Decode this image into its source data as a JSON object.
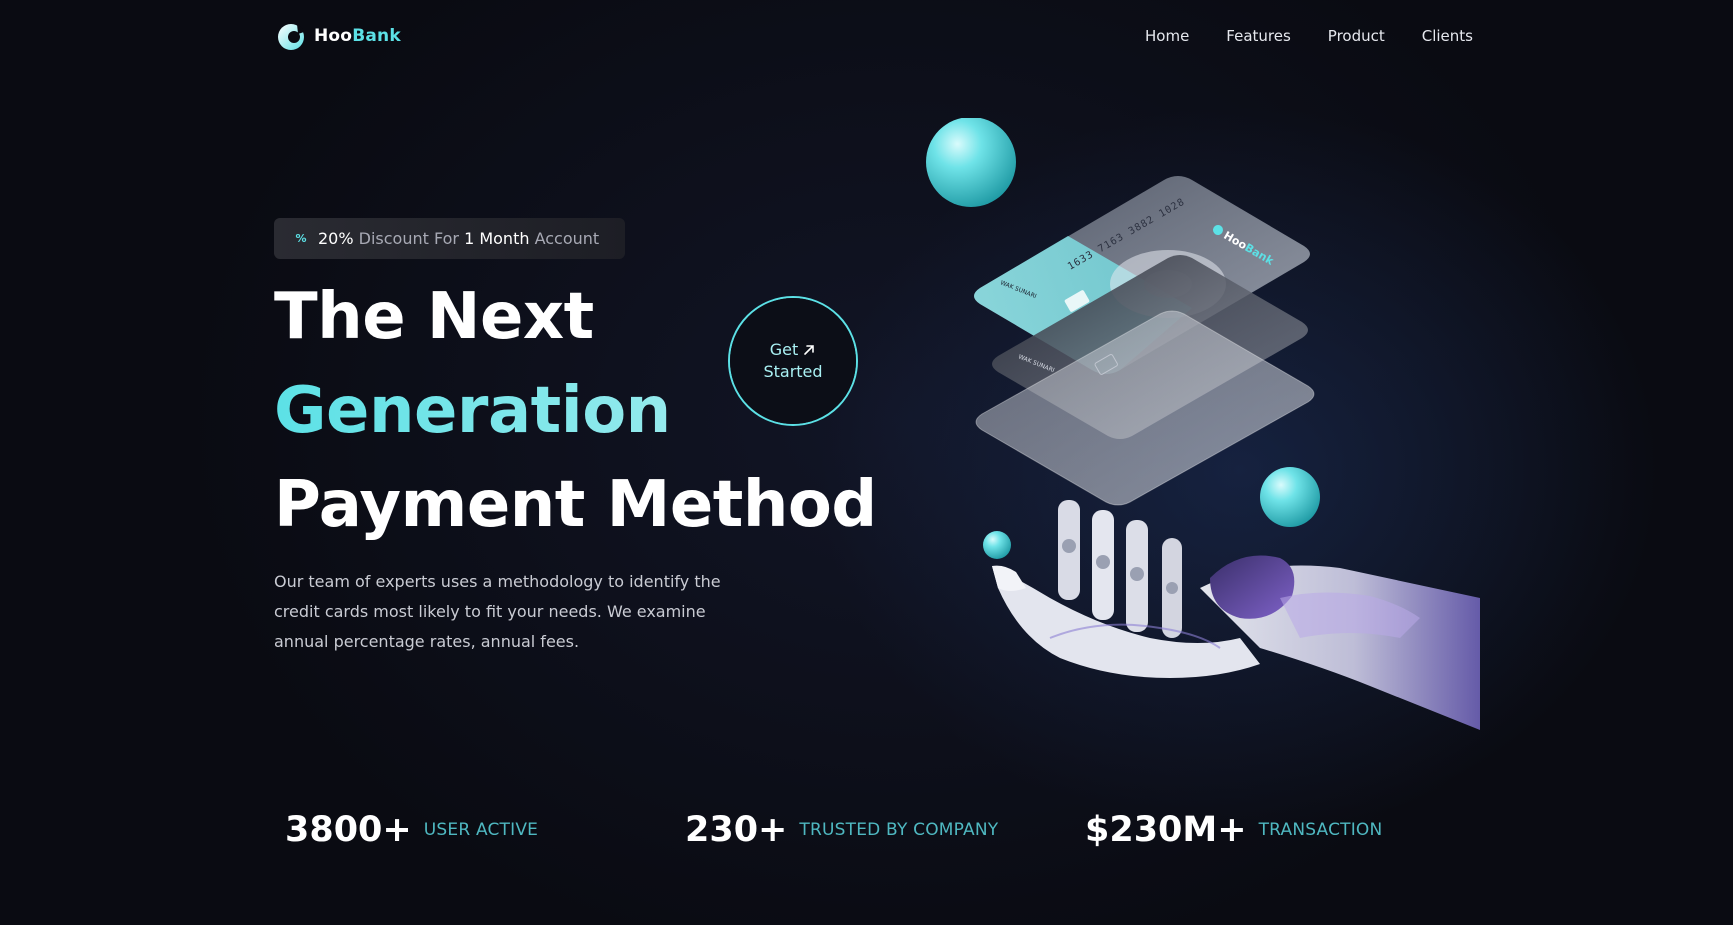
{
  "brand": {
    "name_part1": "Hoo",
    "name_part2": "Bank",
    "accent_color": "#5ce1e6",
    "logo_icon": "hoobank-logo-icon"
  },
  "nav": {
    "items": [
      {
        "label": "Home"
      },
      {
        "label": "Features"
      },
      {
        "label": "Product"
      },
      {
        "label": "Clients"
      }
    ]
  },
  "hero": {
    "badge": {
      "icon": "percent-discount-icon",
      "pct": "20%",
      "text_mid": " Discount For ",
      "months": "1 Month",
      "text_end": " Account"
    },
    "title": {
      "line1": "The Next",
      "line2": "Generation",
      "line3": "Payment Method"
    },
    "cta": {
      "line1": "Get",
      "line2": "Started",
      "icon": "arrow-up-right-icon"
    },
    "description": "Our team of experts uses a methodology to identify the credit cards most likely to fit your needs. We examine annual percentage rates, annual fees.",
    "illustration": {
      "card_brand_part1": "Hoo",
      "card_brand_part2": "Bank",
      "card_number": "1633 7163 3882 1028",
      "card_holder": "WAK SUNARI"
    }
  },
  "stats": [
    {
      "value": "3800+",
      "label": "USER ACTIVE"
    },
    {
      "value": "230+",
      "label": "TRUSTED BY COMPANY"
    },
    {
      "value": "$230M+",
      "label": "TRANSACTION"
    }
  ],
  "colors": {
    "background": "#0a0b12",
    "accent": "#5ce1e6",
    "stat_label": "#4fb8c1"
  }
}
